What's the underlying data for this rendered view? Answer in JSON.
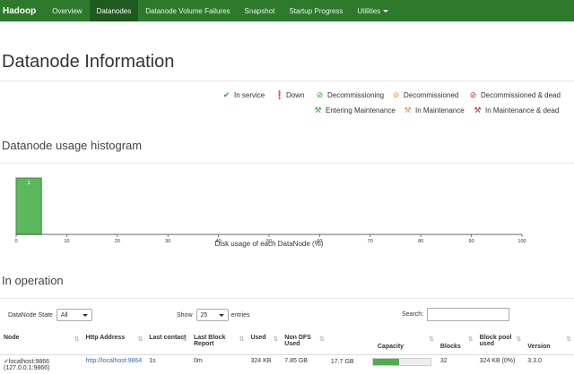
{
  "nav": {
    "brand": "Hadoop",
    "items": [
      "Overview",
      "Datanodes",
      "Datanode Volume Failures",
      "Snapshot",
      "Startup Progress",
      "Utilities"
    ]
  },
  "page_title": "Datanode Information",
  "legend": {
    "in_service": "In service",
    "down": "Down",
    "decommissioning": "Decommissioning",
    "decommissioned": "Decommissioned",
    "decommissioned_dead": "Decommissioned & dead",
    "entering_maintenance": "Entering Maintenance",
    "in_maintenance": "In Maintenance",
    "in_maintenance_dead": "In Maintenance & dead"
  },
  "histogram": {
    "heading": "Datanode usage histogram"
  },
  "chart_data": {
    "type": "bar",
    "xlabel": "Disk usage of each DataNode (%)",
    "xlim": [
      0,
      100
    ],
    "xticks": [
      0,
      10,
      20,
      30,
      40,
      50,
      60,
      70,
      80,
      90,
      100
    ],
    "bins": [
      {
        "x0": 0,
        "x1": 5,
        "count": 1
      }
    ],
    "bar_labels": [
      "1"
    ]
  },
  "operation": {
    "heading": "In operation",
    "state_label": "DataNode State",
    "state_value": "All",
    "show_label": "Show",
    "show_value": "25",
    "entries_label": "entries",
    "search_label": "Search:",
    "columns": [
      "Node",
      "Http Address",
      "Last contact",
      "Last Block Report",
      "Used",
      "Non DFS Used",
      "Capacity",
      "Blocks",
      "Block pool used",
      "Version"
    ],
    "rows": [
      {
        "node": "localhost:9866",
        "node_ip": "(127.0.0.1:9866)",
        "http": "http://localhost:9864",
        "last_contact": "1s",
        "last_block_report": "0m",
        "used": "324 KB",
        "non_dfs": "7.85 GB",
        "capacity_text": "17.7 GB",
        "capacity_pct": 0.45,
        "blocks": "32",
        "bp_used": "324 KB (0%)",
        "version": "3.3.0"
      }
    ]
  },
  "colors": {
    "nav": "#2d7a2d",
    "active": "#1f5a1f",
    "bar": "#5cb85c",
    "link": "#2a6fb2"
  }
}
